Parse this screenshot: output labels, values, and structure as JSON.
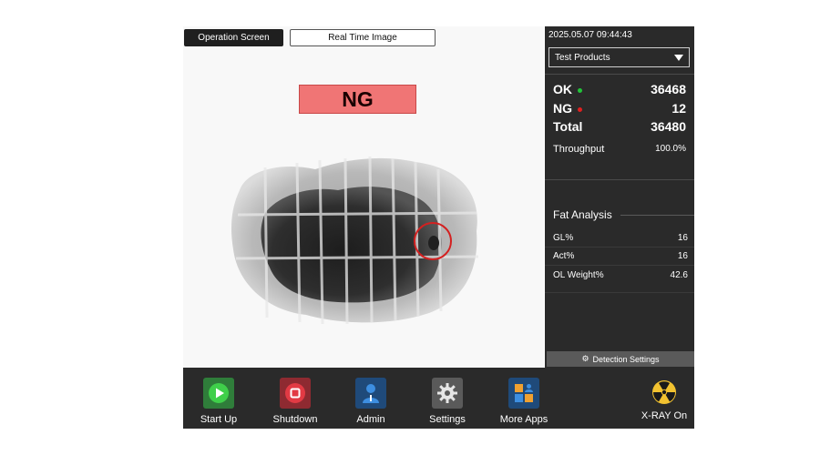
{
  "header": {
    "tab_operation": "Operation Screen",
    "tab_realtime": "Real Time Image"
  },
  "status": {
    "result": "NG",
    "result_color": "#f07575"
  },
  "panel": {
    "timestamp": "2025.05.07  09:44:43",
    "product": "Test Products",
    "counts": {
      "ok_label": "OK",
      "ok_value": "36468",
      "ng_label": "NG",
      "ng_value": "12",
      "total_label": "Total",
      "total_value": "36480"
    },
    "throughput_label": "Throughput",
    "throughput_value": "100.0%",
    "fat": {
      "title": "Fat Analysis",
      "rows": [
        {
          "label": "GL%",
          "value": "16"
        },
        {
          "label": "Act%",
          "value": "16"
        },
        {
          "label": "OL Weight%",
          "value": "42.6"
        }
      ]
    },
    "detection_settings": "Detection Settings"
  },
  "toolbar": {
    "start": "Start Up",
    "shutdown": "Shutdown",
    "admin": "Admin",
    "settings": "Settings",
    "more_apps": "More Apps",
    "xray": "X-RAY On"
  },
  "colors": {
    "ok_dot": "#22c33a",
    "ng_dot": "#e02020",
    "panel_bg": "#2a2a2a",
    "detection_circle": "#d42020"
  },
  "icons": [
    "play-icon",
    "stop-icon",
    "user-icon",
    "gear-icon",
    "apps-grid-icon",
    "radiation-icon",
    "caret-down-icon"
  ]
}
